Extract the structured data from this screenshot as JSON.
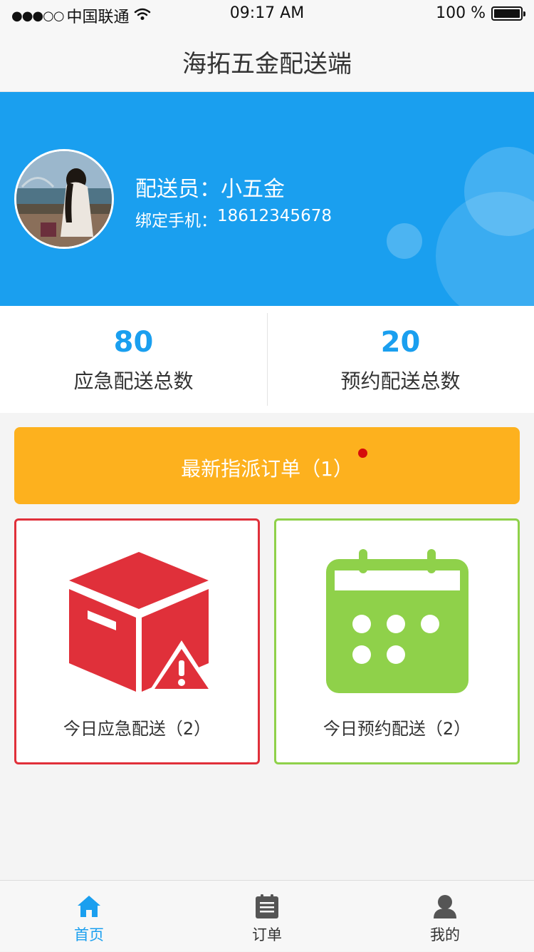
{
  "status_bar": {
    "signal": "●●●○○",
    "carrier": "中国联通",
    "time": "09:17 AM",
    "battery": "100 %"
  },
  "nav": {
    "title": "海拓五金配送端"
  },
  "profile": {
    "courier_label": "配送员：",
    "courier_name": "小五金",
    "phone_label": "绑定手机：",
    "phone": "18612345678"
  },
  "stats": [
    {
      "value": "80",
      "label": "应急配送总数"
    },
    {
      "value": "20",
      "label": "预约配送总数"
    }
  ],
  "assignment_button": {
    "label": "最新指派订单（1）",
    "has_new": true
  },
  "cards": [
    {
      "label": "今日应急配送（2）",
      "icon": "package-warning-icon",
      "color": "#e0303a"
    },
    {
      "label": "今日预约配送（2）",
      "icon": "calendar-icon",
      "color": "#8fd14a"
    }
  ],
  "tabs": [
    {
      "label": "首页",
      "icon": "home-icon",
      "active": true
    },
    {
      "label": "订单",
      "icon": "clipboard-icon",
      "active": false
    },
    {
      "label": "我的",
      "icon": "user-icon",
      "active": false
    }
  ],
  "colors": {
    "primary": "#1a9fef",
    "assign": "#fdb11e",
    "emergency": "#e0303a",
    "scheduled": "#8fd14a",
    "badge": "#d60b0b"
  }
}
